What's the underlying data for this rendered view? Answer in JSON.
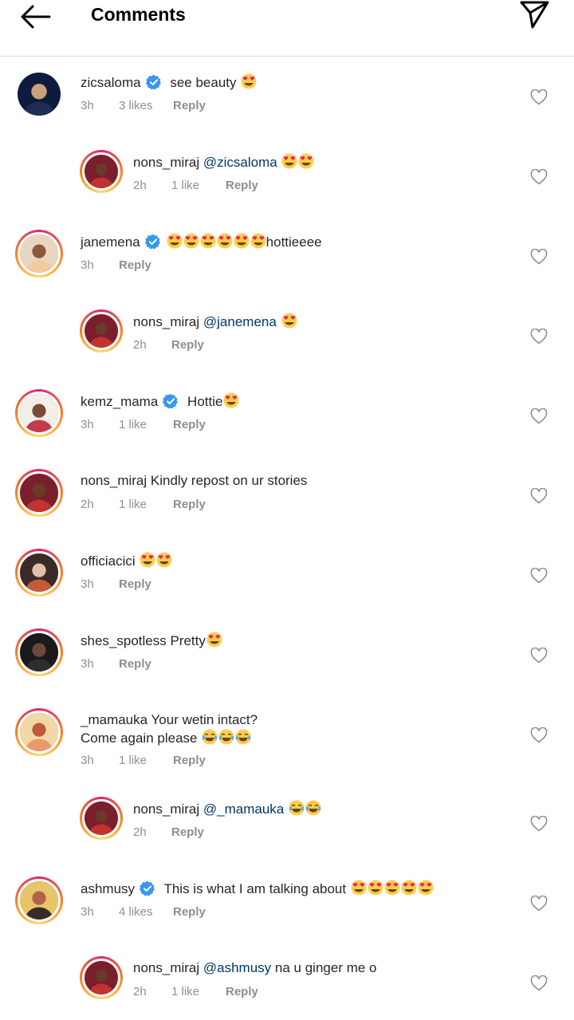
{
  "header": {
    "title": "Comments"
  },
  "comments": [
    {
      "username": "zicsaloma",
      "verified": true,
      "mention": "",
      "text": " see beauty ",
      "emoji_count": 1,
      "time": "3h",
      "likes": "3 likes",
      "reply": "Reply",
      "reply_thread": false,
      "avatar_ring": false
    },
    {
      "username": "nons_miraj",
      "verified": false,
      "mention": "@zicsaloma",
      "text": " ",
      "emoji_count": 2,
      "time": "2h",
      "likes": "1 like",
      "reply": "Reply",
      "reply_thread": true,
      "avatar_ring": true
    },
    {
      "username": "janemena",
      "verified": true,
      "mention": "",
      "text": "",
      "emoji_count": 6,
      "text_after": "hottieeee",
      "time": "3h",
      "likes": "",
      "reply": "Reply",
      "reply_thread": false,
      "avatar_ring": true
    },
    {
      "username": "nons_miraj",
      "verified": false,
      "mention": "@janemena",
      "text": " ",
      "emoji_count": 1,
      "time": "2h",
      "likes": "",
      "reply": "Reply",
      "reply_thread": true,
      "avatar_ring": true
    },
    {
      "username": "kemz_mama",
      "verified": true,
      "mention": "",
      "text": " Hottie",
      "emoji_count": 1,
      "time": "3h",
      "likes": "1 like",
      "reply": "Reply",
      "reply_thread": false,
      "avatar_ring": true
    },
    {
      "username": "nons_miraj",
      "verified": false,
      "mention": "",
      "text": " Kindly repost on ur stories",
      "emoji_count": 0,
      "time": "2h",
      "likes": "1 like",
      "reply": "Reply",
      "reply_thread": false,
      "avatar_ring": true
    },
    {
      "username": "officiacici",
      "verified": false,
      "mention": "",
      "text": " ",
      "emoji_count": 2,
      "time": "3h",
      "likes": "",
      "reply": "Reply",
      "reply_thread": false,
      "avatar_ring": true
    },
    {
      "username": "shes_spotless",
      "verified": false,
      "mention": "",
      "text": " Pretty",
      "emoji_count": 1,
      "time": "3h",
      "likes": "",
      "reply": "Reply",
      "reply_thread": false,
      "avatar_ring": true
    },
    {
      "username": "_mamauka",
      "verified": false,
      "mention": "",
      "text": " Your wetin intact?",
      "text_line2": "Come again please ",
      "emoji_count": 3,
      "emoji_type": "laugh",
      "time": "3h",
      "likes": "1 like",
      "reply": "Reply",
      "reply_thread": false,
      "avatar_ring": true
    },
    {
      "username": "nons_miraj",
      "verified": false,
      "mention": "@_mamauka",
      "text": " ",
      "emoji_count": 2,
      "emoji_type": "laugh",
      "time": "2h",
      "likes": "",
      "reply": "Reply",
      "reply_thread": true,
      "avatar_ring": true
    },
    {
      "username": "ashmusy",
      "verified": true,
      "mention": "",
      "text": " This is what I am talking about ",
      "emoji_count": 5,
      "time": "3h",
      "likes": "4 likes",
      "reply": "Reply",
      "reply_thread": false,
      "avatar_ring": true
    },
    {
      "username": "nons_miraj",
      "verified": false,
      "mention": "@ashmusy",
      "text": " na u ginger me o",
      "emoji_count": 0,
      "time": "2h",
      "likes": "1 like",
      "reply": "Reply",
      "reply_thread": true,
      "avatar_ring": true
    }
  ],
  "icons": {
    "back": "arrow-left-icon",
    "send": "paper-plane-icon",
    "like": "heart-outline-icon",
    "verified": "verified-badge-icon",
    "heart_eyes": "heart-eyes-emoji",
    "laugh": "tears-of-joy-emoji"
  },
  "colors": {
    "text": "#262626",
    "meta": "#8e8e8e",
    "mention": "#00376b",
    "verified": "#3897f0",
    "divider": "#dbdbdb"
  }
}
